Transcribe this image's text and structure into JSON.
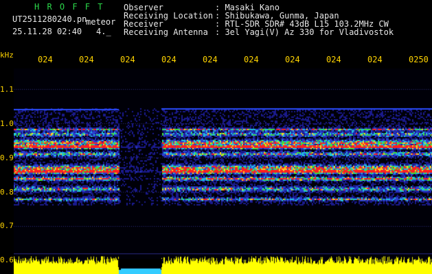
{
  "header": {
    "program": "H R O F F T",
    "file_name": "UT2511280240.pn",
    "mode": "meteor",
    "date_time": "25.11.28 02:40",
    "setting": "4._",
    "labels": [
      "Observer",
      "Receiving Location",
      "Receiver",
      "Receiving Antenna"
    ],
    "values": [
      ": Masaki Kano",
      ": Shibukawa, Gunma, Japan",
      ": RTL-SDR SDR# 43dB L15 103.2MHz CW",
      ": 3el Yagi(V) Az 330 for Vladivostok"
    ]
  },
  "axis": {
    "unit": "kHz",
    "y_ticks": [
      "1.1",
      "1.0",
      "0.9",
      "0.8",
      "0.7",
      "0.6"
    ],
    "x_ticks": [
      "024",
      "024",
      "024",
      "024",
      "024",
      "024",
      "024",
      "024",
      "024",
      "0250"
    ]
  },
  "colors": {
    "background": "#000000",
    "header_green": "#2bd94a",
    "axis_yellow": "#ffd400",
    "spectrum_blue": "#1a1a8c",
    "power_yellow": "#ffff00",
    "power_cyan": "#33ccff"
  }
}
